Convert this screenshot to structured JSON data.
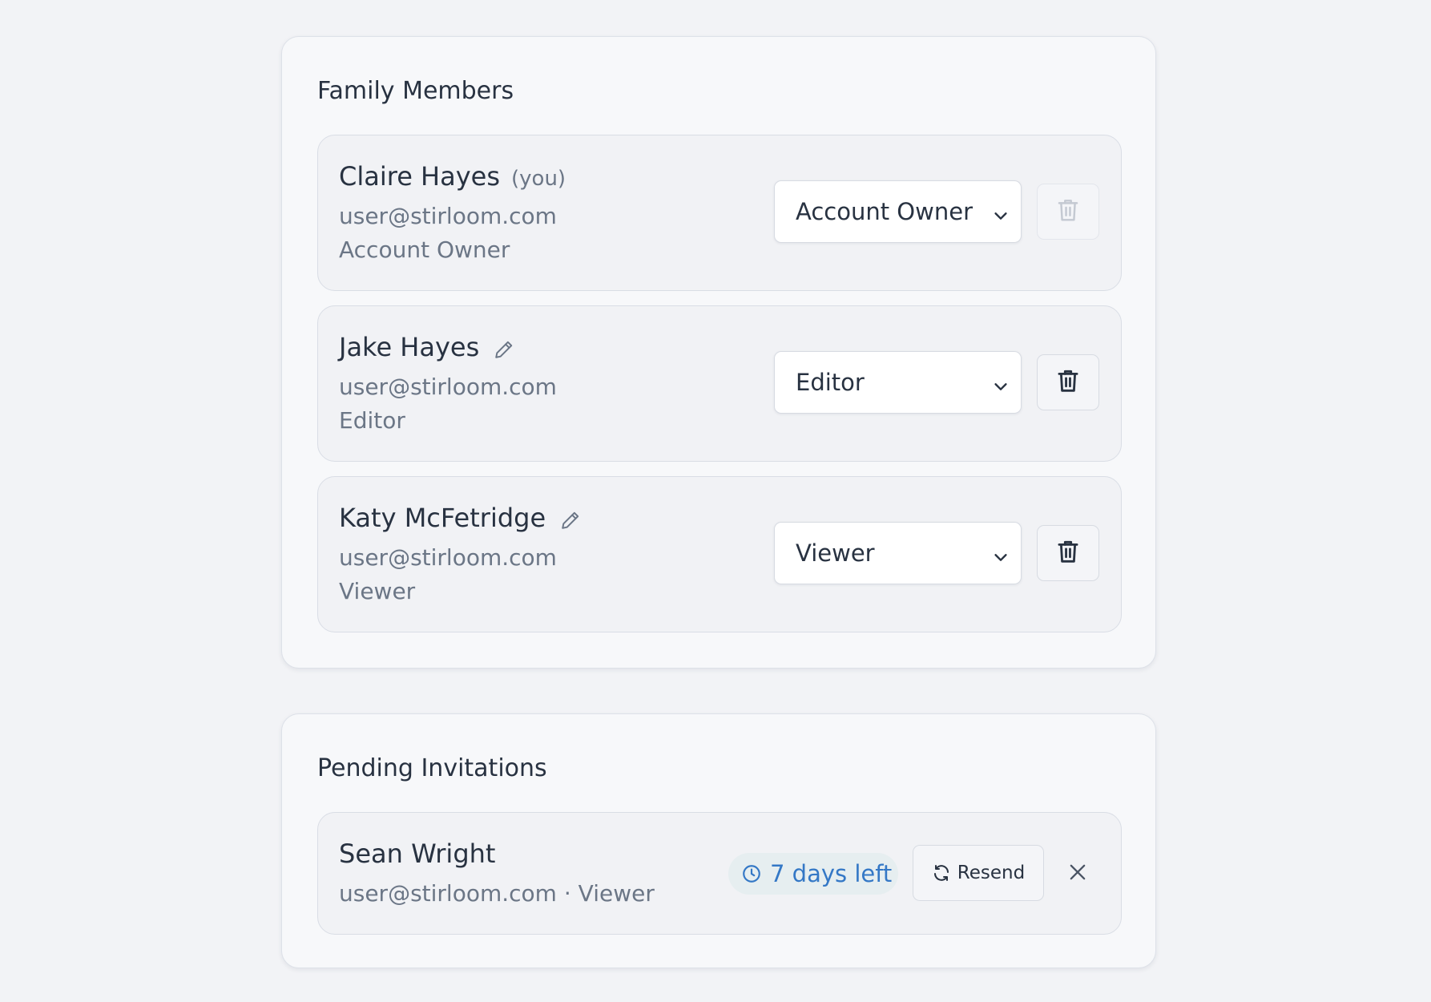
{
  "family_members": {
    "title": "Family Members",
    "members": [
      {
        "name": "Claire Hayes",
        "you_tag": "(you)",
        "email": "user@stirloom.com",
        "role": "Account Owner",
        "selected_role": "Account Owner",
        "delete_disabled": true
      },
      {
        "name": "Jake Hayes",
        "email": "user@stirloom.com",
        "role": "Editor",
        "selected_role": "Editor",
        "delete_disabled": false
      },
      {
        "name": "Katy McFetridge",
        "email": "user@stirloom.com",
        "role": "Viewer",
        "selected_role": "Viewer",
        "delete_disabled": false
      }
    ]
  },
  "pending_invitations": {
    "title": "Pending Invitations",
    "invites": [
      {
        "name": "Sean Wright",
        "detail": "user@stirloom.com · Viewer",
        "expiry": "7 days left",
        "resend_label": "Resend"
      }
    ]
  },
  "icons": {
    "edit": "pencil-icon",
    "select_arrow": "chevron-down-icon",
    "delete": "trash-icon",
    "expiry": "clock-icon",
    "resend": "refresh-icon",
    "cancel": "close-icon"
  },
  "colors": {
    "page_background": "#f2f3f6",
    "card_background": "#f7f8fa",
    "row_background": "#f1f2f5",
    "text_primary": "#283241",
    "text_secondary": "#6b7686",
    "badge_background": "#e6eef0",
    "badge_text": "#3478c6"
  }
}
